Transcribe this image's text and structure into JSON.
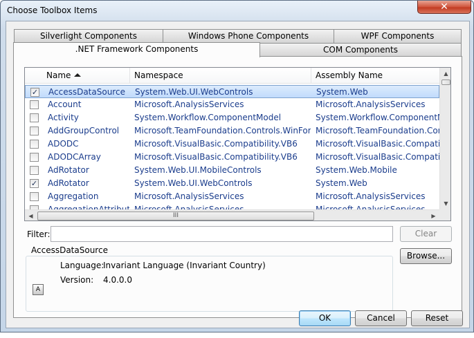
{
  "window": {
    "title": "Choose Toolbox Items",
    "close_glyph": "✕"
  },
  "tabs": {
    "row1": [
      "Silverlight Components",
      "Windows Phone Components",
      "WPF Components"
    ],
    "row2": [
      ".NET Framework Components",
      "COM Components"
    ],
    "active": ".NET Framework Components"
  },
  "list": {
    "columns": [
      "Name",
      "Namespace",
      "Assembly Name"
    ],
    "sort_column": "Name",
    "rows": [
      {
        "checked": true,
        "name": "AccessDataSource",
        "namespace": "System.Web.UI.WebControls",
        "assembly": "System.Web",
        "selected": true
      },
      {
        "checked": false,
        "name": "Account",
        "namespace": "Microsoft.AnalysisServices",
        "assembly": "Microsoft.AnalysisServices"
      },
      {
        "checked": false,
        "name": "Activity",
        "namespace": "System.Workflow.ComponentModel",
        "assembly": "System.Workflow.ComponentMo"
      },
      {
        "checked": false,
        "name": "AddGroupControl",
        "namespace": "Microsoft.TeamFoundation.Controls.WinForms",
        "assembly": "Microsoft.TeamFoundation.Contr"
      },
      {
        "checked": false,
        "name": "ADODC",
        "namespace": "Microsoft.VisualBasic.Compatibility.VB6",
        "assembly": "Microsoft.VisualBasic.Compatibili"
      },
      {
        "checked": false,
        "name": "ADODCArray",
        "namespace": "Microsoft.VisualBasic.Compatibility.VB6",
        "assembly": "Microsoft.VisualBasic.Compatibili"
      },
      {
        "checked": false,
        "name": "AdRotator",
        "namespace": "System.Web.UI.MobileControls",
        "assembly": "System.Web.Mobile"
      },
      {
        "checked": true,
        "name": "AdRotator",
        "namespace": "System.Web.UI.WebControls",
        "assembly": "System.Web"
      },
      {
        "checked": false,
        "name": "Aggregation",
        "namespace": "Microsoft.AnalysisServices",
        "assembly": "Microsoft.AnalysisServices"
      },
      {
        "checked": false,
        "name": "AggregationAttribute",
        "namespace": "Microsoft.AnalysisServices",
        "assembly": "Microsoft.AnalysisServices"
      }
    ],
    "hscroll_grip": "III"
  },
  "filter": {
    "label": "Filter:",
    "value": ""
  },
  "buttons": {
    "clear": "Clear",
    "browse": "Browse...",
    "ok": "OK",
    "cancel": "Cancel",
    "reset": "Reset"
  },
  "details": {
    "group_title": "AccessDataSource",
    "language_label": "Language:",
    "language_value": "Invariant Language (Invariant Country)",
    "version_label": "Version:",
    "version_value": "4.0.0.0"
  }
}
